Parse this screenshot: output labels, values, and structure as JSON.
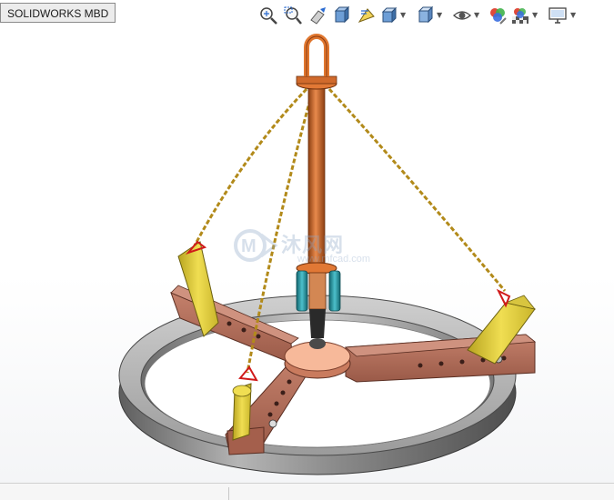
{
  "window": {
    "tab_label": "SOLIDWORKS MBD"
  },
  "toolbar": {
    "tools": [
      {
        "name": "zoom-to-fit-icon"
      },
      {
        "name": "zoom-to-area-icon"
      },
      {
        "name": "previous-view-icon"
      },
      {
        "name": "section-view-icon"
      },
      {
        "name": "dynamic-annotation-views-icon"
      },
      {
        "name": "view-orientation-icon"
      },
      {
        "name": "display-style-icon"
      },
      {
        "name": "hide-show-items-icon"
      },
      {
        "name": "edit-appearance-icon"
      },
      {
        "name": "apply-scene-icon"
      },
      {
        "name": "view-settings-icon"
      }
    ]
  },
  "watermark": {
    "cn_text": "沐风网",
    "en_text": "www.mfcad.com"
  },
  "colors": {
    "background": "#ffffff",
    "ring": "#8c8c8c",
    "beam": "#9a5a48",
    "chain": "#b28a1a",
    "pad": "#e2cf3a",
    "rod": "#c0631e",
    "hub": "#f3b08e",
    "cylinder": "#2e93a0"
  }
}
